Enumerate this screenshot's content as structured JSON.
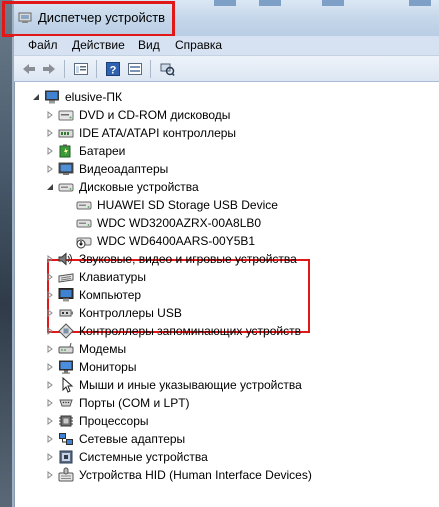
{
  "window": {
    "title": "Диспетчер устройств"
  },
  "menu": [
    "Файл",
    "Действие",
    "Вид",
    "Справка"
  ],
  "toolbar": [
    "back-icon",
    "forward-icon",
    "properties-view-icon",
    "help-icon",
    "show-hidden-icon",
    "scan-hardware-icon"
  ],
  "tree": {
    "root": "elusive-ПК",
    "categories": [
      {
        "label": "DVD и CD-ROM дисководы",
        "icon": "dvd-drive-icon",
        "expanded": false
      },
      {
        "label": "IDE ATA/ATAPI контроллеры",
        "icon": "ide-controller-icon",
        "expanded": false
      },
      {
        "label": "Батареи",
        "icon": "battery-icon",
        "expanded": false
      },
      {
        "label": "Видеоадаптеры",
        "icon": "display-adapter-icon",
        "expanded": false
      },
      {
        "label": "Дисковые устройства",
        "icon": "disk-drive-icon",
        "expanded": true,
        "children": [
          {
            "label": "HUAWEI SD Storage USB Device",
            "icon": "disk-drive-icon"
          },
          {
            "label": "WDC WD3200AZRX-00A8LB0",
            "icon": "disk-drive-icon"
          },
          {
            "label": "WDC WD6400AARS-00Y5B1",
            "icon": "disk-drive-warning-icon"
          }
        ]
      },
      {
        "label": "Звуковые, видео и игровые устройства",
        "icon": "sound-icon",
        "expanded": false
      },
      {
        "label": "Клавиатуры",
        "icon": "keyboard-icon",
        "expanded": false
      },
      {
        "label": "Компьютер",
        "icon": "computer-icon",
        "expanded": false
      },
      {
        "label": "Контроллеры USB",
        "icon": "usb-controller-icon",
        "expanded": false
      },
      {
        "label": "Контроллеры запоминающих устройств",
        "icon": "storage-controller-icon",
        "expanded": false
      },
      {
        "label": "Модемы",
        "icon": "modem-icon",
        "expanded": false
      },
      {
        "label": "Мониторы",
        "icon": "monitor-icon",
        "expanded": false
      },
      {
        "label": "Мыши и иные указывающие устройства",
        "icon": "mouse-icon",
        "expanded": false
      },
      {
        "label": "Порты (COM и LPT)",
        "icon": "port-icon",
        "expanded": false
      },
      {
        "label": "Процессоры",
        "icon": "processor-icon",
        "expanded": false
      },
      {
        "label": "Сетевые адаптеры",
        "icon": "network-adapter-icon",
        "expanded": false
      },
      {
        "label": "Системные устройства",
        "icon": "system-device-icon",
        "expanded": false
      },
      {
        "label": "Устройства HID (Human Interface Devices)",
        "icon": "hid-icon",
        "expanded": false
      }
    ]
  },
  "colors": {
    "highlight": "#e01818",
    "titlebar": "#c5d7ea",
    "menubar": "#d6e2f1"
  }
}
